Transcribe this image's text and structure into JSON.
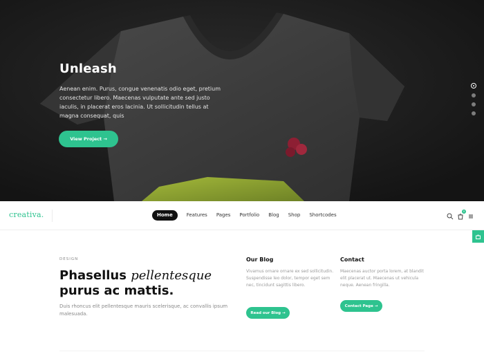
{
  "hero": {
    "title": "Unleash",
    "text": "Aenean enim. Purus, congue venenatis odio eget, pretium consectetur libero. Maecenas vulputate ante sed justo iaculis, in placerat eros lacinia. Ut sollicitudin tellus at magna consequat, quis",
    "button_label": "View Project →",
    "slides": 4,
    "active_slide": 1
  },
  "nav": {
    "logo": "creativa.",
    "items": [
      {
        "label": "Home",
        "active": true
      },
      {
        "label": "Features",
        "active": false
      },
      {
        "label": "Pages",
        "active": false
      },
      {
        "label": "Portfolio",
        "active": false
      },
      {
        "label": "Blog",
        "active": false
      },
      {
        "label": "Shop",
        "active": false
      },
      {
        "label": "Shortcodes",
        "active": false
      }
    ],
    "icons": [
      "search-icon",
      "cart-icon",
      "menu-icon"
    ],
    "cart_count": "0"
  },
  "content": {
    "eyebrow": "DESIGN",
    "headline_part1": "Phasellus",
    "headline_italic": "pellentesque",
    "headline_part2": "purus ac mattis.",
    "body": "Duis rhoncus elit pellentesque mauris scelerisque, ac convallis ipsum malesuada."
  },
  "blog": {
    "title": "Our Blog",
    "text": "Vivamus ornare ornare ex sed sollicitudin. Suspendisse leo dolor, tempor eget sem nec, tincidunt sagittis libero.",
    "button_label": "Read our Blog →"
  },
  "contact": {
    "title": "Contact",
    "text": "Maecenas auctor porta lorem, at blandit elit placerat ut. Maecenas ut vehicula neque. Aenean fringilla.",
    "button_label": "Contact Page →"
  },
  "colors": {
    "accent": "#2ec38f",
    "dark": "#111111",
    "hero_bg": "#1c1c1c"
  }
}
